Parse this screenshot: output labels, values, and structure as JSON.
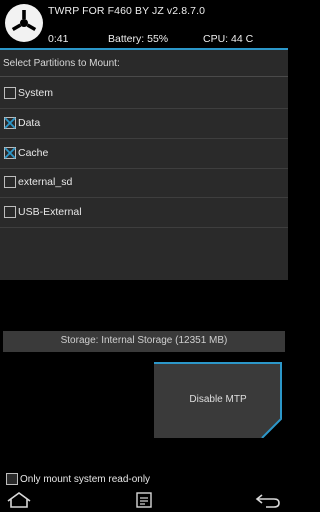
{
  "header": {
    "title": "TWRP FOR F460 BY JZ  v2.8.7.0",
    "time": "0:41",
    "battery": "Battery: 55%",
    "cpu": "CPU: 44 C",
    "logo_icon": "twrp-logo-icon"
  },
  "colors": {
    "accent": "#2c97c9",
    "panel": "#2a2a2a",
    "button": "#3a3a3a"
  },
  "list": {
    "heading": "Select Partitions to Mount:",
    "items": [
      {
        "label": "System",
        "checked": false
      },
      {
        "label": "Data",
        "checked": true
      },
      {
        "label": "Cache",
        "checked": true
      },
      {
        "label": "external_sd",
        "checked": false
      },
      {
        "label": "USB-External",
        "checked": false
      }
    ]
  },
  "storage_button": {
    "label": "Storage: Internal Storage (12351 MB)"
  },
  "mtp_button": {
    "label": "Disable MTP"
  },
  "readonly_option": {
    "label": "Only mount system read-only",
    "checked": false
  },
  "navbar": {
    "icons": [
      "home-icon",
      "console-icon",
      "back-icon"
    ]
  }
}
